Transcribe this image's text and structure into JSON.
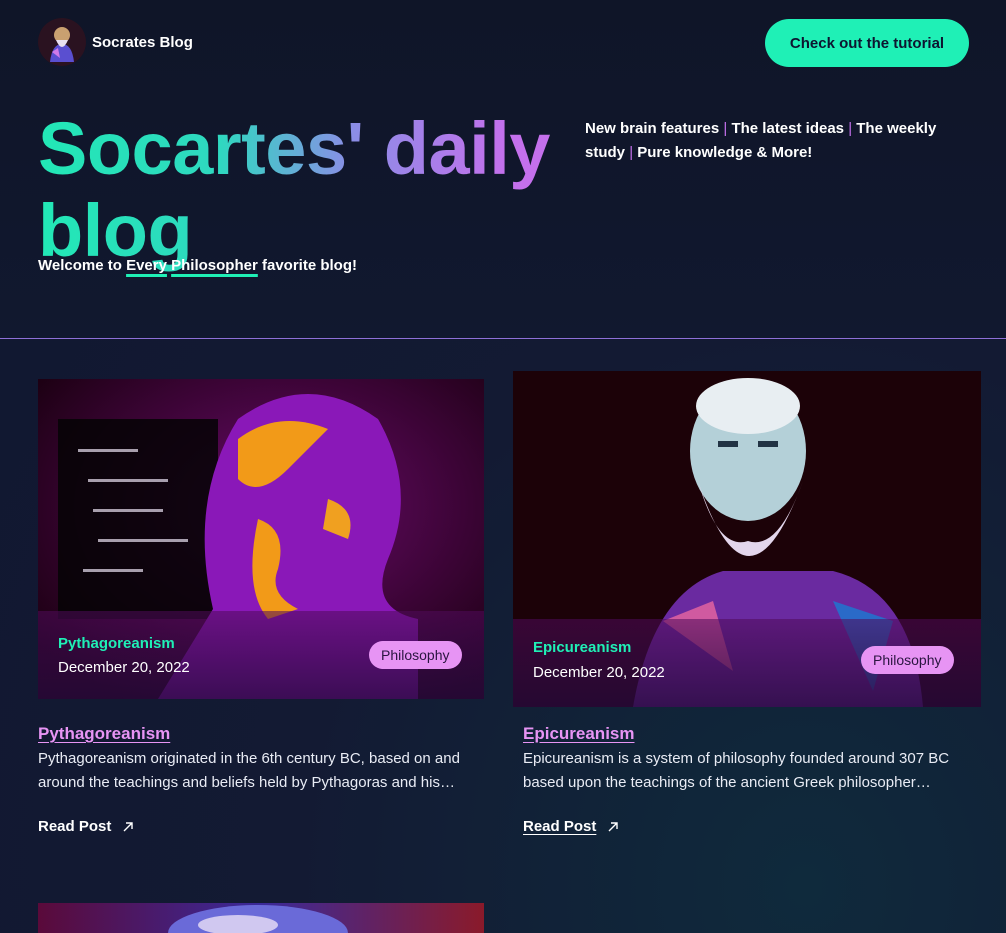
{
  "brand": {
    "name": "Socrates Blog"
  },
  "cta": {
    "label": "Check out the tutorial"
  },
  "hero": {
    "title": "Socartes' daily blog",
    "subtitle_prefix": "Welcome to ",
    "subtitle_u1": "Every",
    "subtitle_u2": "Philosopher",
    "subtitle_u3": "",
    "subtitle_suffix": " favorite blog!"
  },
  "tagline": {
    "item1": "New brain features",
    "item2": "The latest ideas",
    "item3": "The weekly study",
    "item4": "Pure knowledge & More!",
    "separator": "|"
  },
  "posts": [
    {
      "category": "Pythagoreanism",
      "date": "December 20, 2022",
      "tag": "Philosophy",
      "title": "Pythagoreanism",
      "excerpt": "Pythagoreanism originated in the 6th century BC, based on and around the teachings and beliefs held by Pythagoras and his followers.",
      "read_label": "Read Post"
    },
    {
      "category": "Epicureanism",
      "date": "December 20, 2022",
      "tag": "Philosophy",
      "title": "Epicureanism",
      "excerpt": "Epicureanism is a system of philosophy founded around 307 BC based upon the teachings of the ancient Greek philosopher Epicurus.",
      "read_label": "Read Post"
    }
  ],
  "colors": {
    "accent": "#1ff0b6",
    "pink": "#e794f4",
    "purple": "#c470ec",
    "bg": "#11182f"
  }
}
